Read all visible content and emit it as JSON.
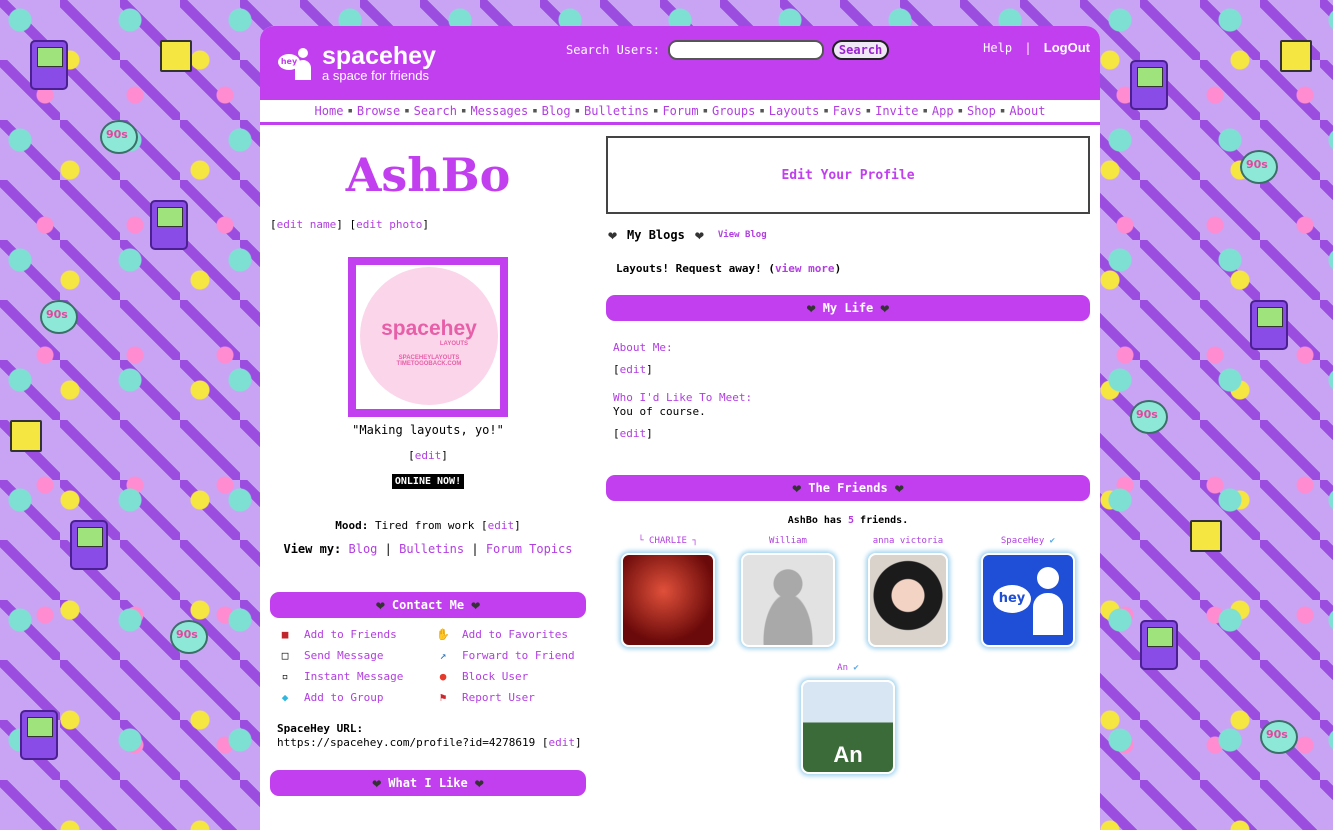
{
  "header": {
    "logo_text": "spacehey",
    "logo_badge": "hey",
    "tagline": "a space for friends",
    "search_label": "Search Users:",
    "search_value": "",
    "search_button": "Search",
    "help": "Help",
    "separator": "|",
    "logout": "LogOut"
  },
  "nav": [
    "Home",
    "Browse",
    "Search",
    "Messages",
    "Blog",
    "Bulletins",
    "Forum",
    "Groups",
    "Layouts",
    "Favs",
    "Invite",
    "App",
    "Shop",
    "About"
  ],
  "profile": {
    "name": "AshBo",
    "edit_name": "edit name",
    "edit_photo": "edit photo",
    "photo_brand": "spacehey",
    "photo_sub": "LAYOUTS",
    "photo_line1": "SPACEHEYLAYOUTS",
    "photo_line2": "TIMETOGOBACK.COM",
    "quote": "\"Making layouts, yo!\"",
    "edit": "edit",
    "online": "ONLINE NOW!",
    "mood_label": "Mood:",
    "mood_value": "Tired from work",
    "view_label": "View my:",
    "view_blog": "Blog",
    "view_bulletins": "Bulletins",
    "view_forum": "Forum Topics"
  },
  "contact": {
    "title": "Contact Me",
    "items": {
      "add_friends": "Add to Friends",
      "add_favorites": "Add to Favorites",
      "send_message": "Send Message",
      "forward": "Forward to Friend",
      "instant": "Instant Message",
      "block": "Block User",
      "add_group": "Add to Group",
      "report": "Report User"
    },
    "url_label": "SpaceHey URL:",
    "url_value": "https://spacehey.com/profile?id=4278619",
    "url_edit": "edit"
  },
  "what_i_like": "What I Like",
  "right": {
    "edit_profile": "Edit Your Profile",
    "blogs_title": "My Blogs",
    "view_blog": "View Blog",
    "blog_entry": "Layouts! Request away!",
    "view_more": "view more",
    "mylife_title": "My Life",
    "about_label": "About Me:",
    "meet_label": "Who I'd Like To Meet:",
    "meet_value": "You of course.",
    "edit": "edit"
  },
  "friends": {
    "title": "The Friends",
    "count_prefix": "AshBo has",
    "count": "5",
    "count_suffix": "friends.",
    "list": [
      {
        "name": "└ CHARLIE ┐"
      },
      {
        "name": "William"
      },
      {
        "name": "anna victoria"
      },
      {
        "name": "SpaceHey"
      },
      {
        "name": "An"
      }
    ]
  },
  "colors": {
    "accent": "#c13fef",
    "link": "#b23ee0"
  },
  "icons": [
    "heart-icon",
    "car-icon",
    "speech-icon",
    "mailbox-icon",
    "gem-icon",
    "hand-icon",
    "arrow-icon",
    "stop-icon",
    "flag-icon",
    "verified-icon"
  ]
}
